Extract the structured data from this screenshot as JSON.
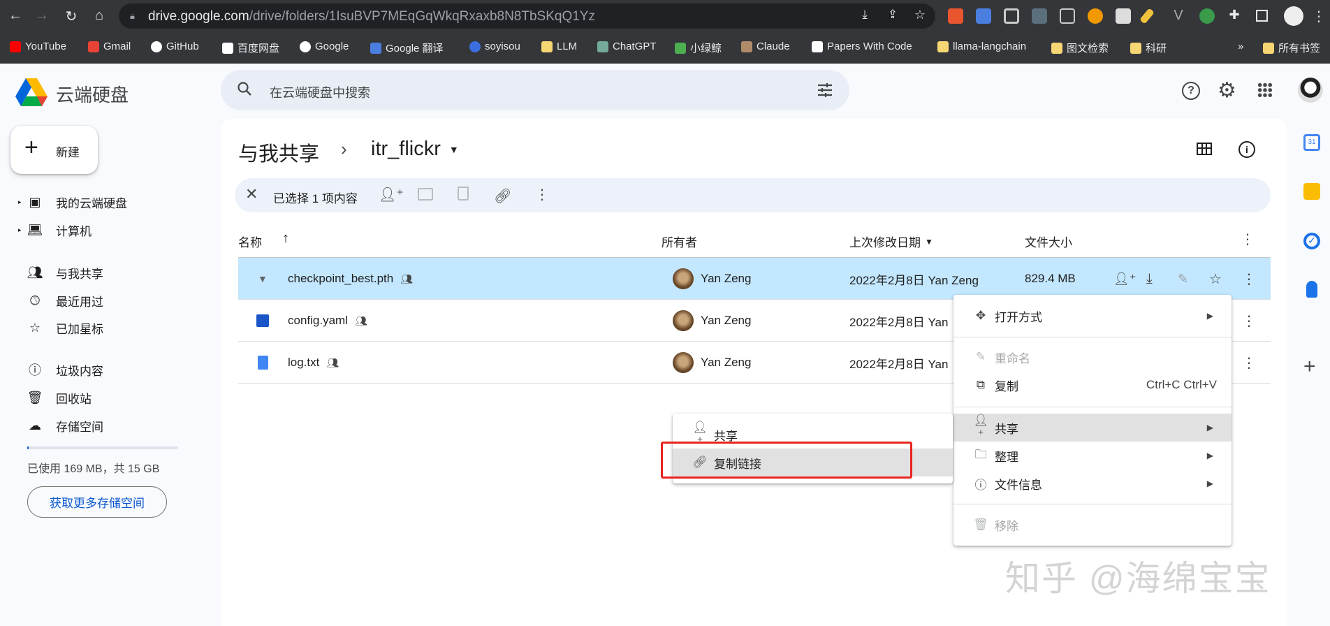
{
  "browser": {
    "url_host": "drive.google.com",
    "url_path": "/drive/folders/1IsuBVP7MEqGqWkqRxaxb8N8TbSKqQ1Yz",
    "bookmarks": [
      "YouTube",
      "Gmail",
      "GitHub",
      "百度网盘",
      "Google",
      "Google 翻译",
      "soyisou",
      "LLM",
      "ChatGPT",
      "小绿鲸",
      "Claude",
      "Papers With Code",
      "llama-langchain",
      "图文检索",
      "科研"
    ],
    "more_bookmarks": "»",
    "all_bookmarks": "所有书签"
  },
  "app": {
    "title": "云端硬盘",
    "search_placeholder": "在云端硬盘中搜索"
  },
  "sidebar": {
    "new_label": "新建",
    "items": [
      {
        "label": "我的云端硬盘",
        "icon": "drive-icon"
      },
      {
        "label": "计算机",
        "icon": "computer-icon"
      },
      {
        "label": "与我共享",
        "icon": "shared-icon"
      },
      {
        "label": "最近用过",
        "icon": "clock-icon"
      },
      {
        "label": "已加星标",
        "icon": "star-icon"
      },
      {
        "label": "垃圾内容",
        "icon": "spam-icon"
      },
      {
        "label": "回收站",
        "icon": "trash-icon"
      },
      {
        "label": "存储空间",
        "icon": "cloud-icon"
      }
    ],
    "storage_used_fraction": 0.011,
    "storage_text": "已使用 169 MB，共 15 GB",
    "get_storage_label": "获取更多存储空间"
  },
  "breadcrumb": {
    "root": "与我共享",
    "sep": "›",
    "folder": "itr_flickr"
  },
  "selection": {
    "text": "已选择 1 项内容"
  },
  "columns": {
    "name": "名称",
    "owner": "所有者",
    "modified": "上次修改日期",
    "size": "文件大小"
  },
  "files": [
    {
      "name": "checkpoint_best.pth",
      "owner": "Yan Zeng",
      "modified": "2022年2月8日 Yan Zeng",
      "size": "829.4 MB",
      "selected": true
    },
    {
      "name": "config.yaml",
      "owner": "Yan Zeng",
      "modified": "2022年2月8日 Yan",
      "size": ""
    },
    {
      "name": "log.txt",
      "owner": "Yan Zeng",
      "modified": "2022年2月8日 Yan",
      "size": ""
    }
  ],
  "context_menu": {
    "open_with": "打开方式",
    "rename": "重命名",
    "copy": "复制",
    "copy_shortcut": "Ctrl+C Ctrl+V",
    "share": "共享",
    "organize": "整理",
    "file_info": "文件信息",
    "remove": "移除"
  },
  "submenu": {
    "share": "共享",
    "copy_link": "复制链接"
  },
  "watermark": "知乎 @海绵宝宝"
}
